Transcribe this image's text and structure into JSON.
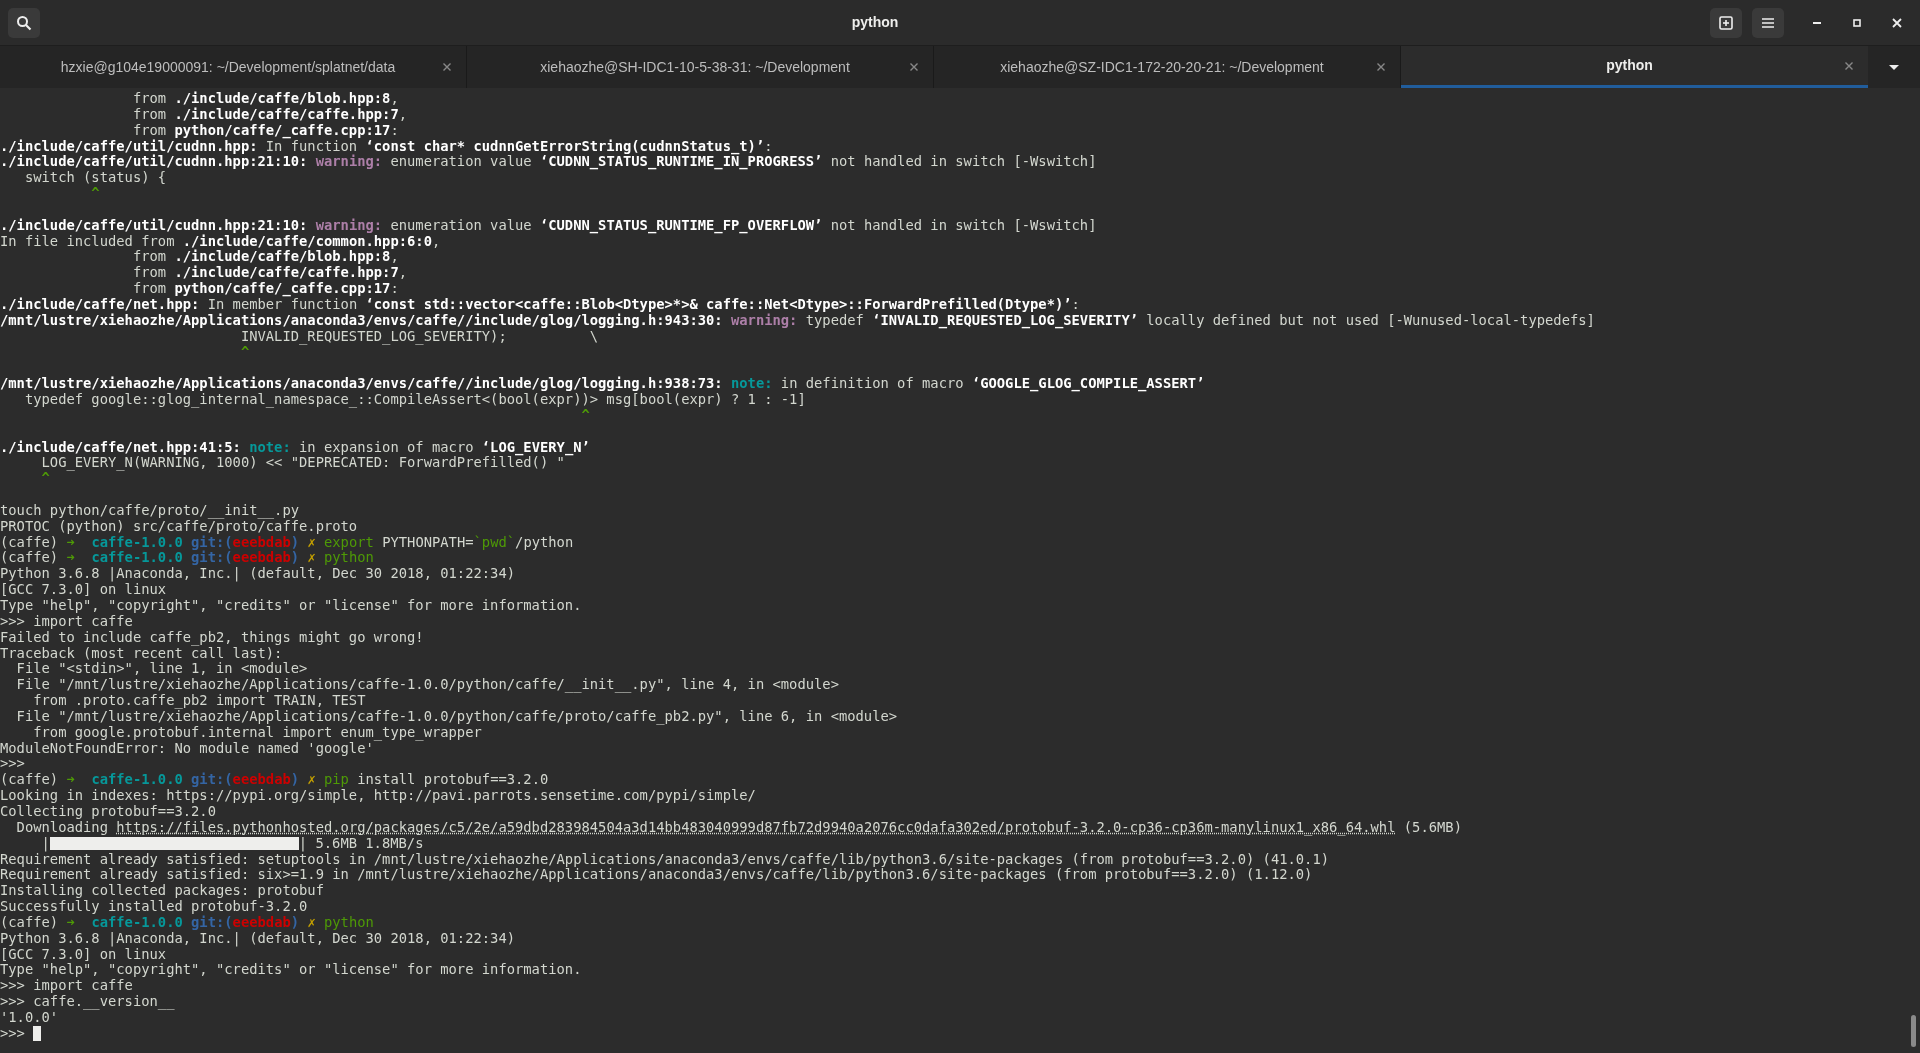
{
  "window": {
    "title": "python"
  },
  "tabs": [
    {
      "label": "hzxie@g104e19000091: ~/Development/splatnet/data",
      "selected": false
    },
    {
      "label": "xiehaozhe@SH-IDC1-10-5-38-31: ~/Development",
      "selected": false
    },
    {
      "label": "xiehaozhe@SZ-IDC1-172-20-20-21: ~/Development",
      "selected": false
    },
    {
      "label": "python",
      "selected": true
    }
  ],
  "terminal": {
    "lines": [
      {
        "segments": [
          {
            "kind": "text",
            "text": "                from "
          },
          {
            "kind": "bold",
            "text": "./include/caffe/blob.hpp:8"
          },
          {
            "kind": "text",
            "text": ","
          }
        ]
      },
      {
        "segments": [
          {
            "kind": "text",
            "text": "                from "
          },
          {
            "kind": "bold",
            "text": "./include/caffe/caffe.hpp:7"
          },
          {
            "kind": "text",
            "text": ","
          }
        ]
      },
      {
        "segments": [
          {
            "kind": "text",
            "text": "                from "
          },
          {
            "kind": "bold",
            "text": "python/caffe/_caffe.cpp:17"
          },
          {
            "kind": "text",
            "text": ":"
          }
        ]
      },
      {
        "segments": [
          {
            "kind": "bold",
            "text": "./include/caffe/util/cudnn.hpp:"
          },
          {
            "kind": "text",
            "text": " In function "
          },
          {
            "kind": "bold",
            "text": "‘const char* cudnnGetErrorString(cudnnStatus_t)’"
          },
          {
            "kind": "text",
            "text": ":"
          }
        ]
      },
      {
        "segments": [
          {
            "kind": "bold",
            "text": "./include/caffe/util/cudnn.hpp:21:10: "
          },
          {
            "kind": "warning",
            "text": "warning:"
          },
          {
            "kind": "text",
            "text": " enumeration value "
          },
          {
            "kind": "bold",
            "text": "‘CUDNN_STATUS_RUNTIME_IN_PROGRESS’"
          },
          {
            "kind": "text",
            "text": " not handled in switch [-Wswitch]"
          }
        ]
      },
      {
        "segments": [
          {
            "kind": "text",
            "text": "   switch (status) {"
          }
        ]
      },
      {
        "segments": [
          {
            "kind": "caret",
            "text": "           ^"
          }
        ]
      },
      {
        "kind": "blank"
      },
      {
        "segments": [
          {
            "kind": "bold",
            "text": "./include/caffe/util/cudnn.hpp:21:10: "
          },
          {
            "kind": "warning",
            "text": "warning:"
          },
          {
            "kind": "text",
            "text": " enumeration value "
          },
          {
            "kind": "bold",
            "text": "‘CUDNN_STATUS_RUNTIME_FP_OVERFLOW’"
          },
          {
            "kind": "text",
            "text": " not handled in switch [-Wswitch]"
          }
        ]
      },
      {
        "segments": [
          {
            "kind": "text",
            "text": "In file included from "
          },
          {
            "kind": "bold",
            "text": "./include/caffe/common.hpp:6:0"
          },
          {
            "kind": "text",
            "text": ","
          }
        ]
      },
      {
        "segments": [
          {
            "kind": "text",
            "text": "                from "
          },
          {
            "kind": "bold",
            "text": "./include/caffe/blob.hpp:8"
          },
          {
            "kind": "text",
            "text": ","
          }
        ]
      },
      {
        "segments": [
          {
            "kind": "text",
            "text": "                from "
          },
          {
            "kind": "bold",
            "text": "./include/caffe/caffe.hpp:7"
          },
          {
            "kind": "text",
            "text": ","
          }
        ]
      },
      {
        "segments": [
          {
            "kind": "text",
            "text": "                from "
          },
          {
            "kind": "bold",
            "text": "python/caffe/_caffe.cpp:17"
          },
          {
            "kind": "text",
            "text": ":"
          }
        ]
      },
      {
        "segments": [
          {
            "kind": "bold",
            "text": "./include/caffe/net.hpp:"
          },
          {
            "kind": "text",
            "text": " In member function "
          },
          {
            "kind": "bold",
            "text": "‘const std::vector<caffe::Blob<Dtype>*>& caffe::Net<Dtype>::ForwardPrefilled(Dtype*)’"
          },
          {
            "kind": "text",
            "text": ":"
          }
        ]
      },
      {
        "segments": [
          {
            "kind": "bold",
            "text": "/mnt/lustre/xiehaozhe/Applications/anaconda3/envs/caffe//include/glog/logging.h:943:30: "
          },
          {
            "kind": "warning",
            "text": "warning:"
          },
          {
            "kind": "text",
            "text": " typedef "
          },
          {
            "kind": "bold",
            "text": "‘INVALID_REQUESTED_LOG_SEVERITY’"
          },
          {
            "kind": "text",
            "text": " locally defined but not used [-Wunused-local-typedefs]"
          }
        ]
      },
      {
        "segments": [
          {
            "kind": "text",
            "text": "                             INVALID_REQUESTED_LOG_SEVERITY);          \\"
          }
        ]
      },
      {
        "segments": [
          {
            "kind": "caret",
            "text": "                             ^"
          }
        ]
      },
      {
        "kind": "blank"
      },
      {
        "segments": [
          {
            "kind": "bold",
            "text": "/mnt/lustre/xiehaozhe/Applications/anaconda3/envs/caffe//include/glog/logging.h:938:73: "
          },
          {
            "kind": "note",
            "text": "note:"
          },
          {
            "kind": "text",
            "text": " in definition of macro "
          },
          {
            "kind": "bold",
            "text": "‘GOOGLE_GLOG_COMPILE_ASSERT’"
          }
        ]
      },
      {
        "segments": [
          {
            "kind": "text",
            "text": "   typedef google::glog_internal_namespace_::CompileAssert<(bool(expr))> msg[bool(expr) ? 1 : -1]"
          }
        ]
      },
      {
        "segments": [
          {
            "kind": "caret",
            "text": "                                                                      ^"
          }
        ]
      },
      {
        "kind": "blank"
      },
      {
        "segments": [
          {
            "kind": "bold",
            "text": "./include/caffe/net.hpp:41:5: "
          },
          {
            "kind": "note",
            "text": "note:"
          },
          {
            "kind": "text",
            "text": " in expansion of macro "
          },
          {
            "kind": "bold",
            "text": "‘LOG_EVERY_N’"
          }
        ]
      },
      {
        "segments": [
          {
            "kind": "text",
            "text": "     LOG_EVERY_N(WARNING, 1000) << \"DEPRECATED: ForwardPrefilled() \""
          }
        ]
      },
      {
        "segments": [
          {
            "kind": "caret",
            "text": "     ^"
          }
        ]
      },
      {
        "kind": "blank"
      },
      {
        "segments": [
          {
            "kind": "text",
            "text": "touch python/caffe/proto/__init__.py"
          }
        ]
      },
      {
        "segments": [
          {
            "kind": "text",
            "text": "PROTOC (python) src/caffe/proto/caffe.proto"
          }
        ]
      },
      {
        "segments": [
          {
            "kind": "text",
            "text": "(caffe) "
          },
          {
            "kind": "arrow",
            "text": "➜  "
          },
          {
            "kind": "dir",
            "text": "caffe-1.0.0 "
          },
          {
            "kind": "git",
            "text": "git:("
          },
          {
            "kind": "hash",
            "text": "eeebdab"
          },
          {
            "kind": "git",
            "text": ")"
          },
          {
            "kind": "mark",
            "text": " ✗ "
          },
          {
            "kind": "cmd",
            "text": "export"
          },
          {
            "kind": "text",
            "text": " PYTHONPATH="
          },
          {
            "kind": "cmd",
            "text": "`pwd`"
          },
          {
            "kind": "text",
            "text": "/python"
          }
        ]
      },
      {
        "segments": [
          {
            "kind": "text",
            "text": "(caffe) "
          },
          {
            "kind": "arrow",
            "text": "➜  "
          },
          {
            "kind": "dir",
            "text": "caffe-1.0.0 "
          },
          {
            "kind": "git",
            "text": "git:("
          },
          {
            "kind": "hash",
            "text": "eeebdab"
          },
          {
            "kind": "git",
            "text": ")"
          },
          {
            "kind": "mark",
            "text": " ✗ "
          },
          {
            "kind": "cmd",
            "text": "python"
          }
        ]
      },
      {
        "segments": [
          {
            "kind": "text",
            "text": "Python 3.6.8 |Anaconda, Inc.| (default, Dec 30 2018, 01:22:34)"
          }
        ]
      },
      {
        "segments": [
          {
            "kind": "text",
            "text": "[GCC 7.3.0] on linux"
          }
        ]
      },
      {
        "segments": [
          {
            "kind": "text",
            "text": "Type \"help\", \"copyright\", \"credits\" or \"license\" for more information."
          }
        ]
      },
      {
        "segments": [
          {
            "kind": "text",
            "text": ">>> import caffe"
          }
        ]
      },
      {
        "segments": [
          {
            "kind": "text",
            "text": "Failed to include caffe_pb2, things might go wrong!"
          }
        ]
      },
      {
        "segments": [
          {
            "kind": "text",
            "text": "Traceback (most recent call last):"
          }
        ]
      },
      {
        "segments": [
          {
            "kind": "text",
            "text": "  File \"<stdin>\", line 1, in <module>"
          }
        ]
      },
      {
        "segments": [
          {
            "kind": "text",
            "text": "  File \"/mnt/lustre/xiehaozhe/Applications/caffe-1.0.0/python/caffe/__init__.py\", line 4, in <module>"
          }
        ]
      },
      {
        "segments": [
          {
            "kind": "text",
            "text": "    from .proto.caffe_pb2 import TRAIN, TEST"
          }
        ]
      },
      {
        "segments": [
          {
            "kind": "text",
            "text": "  File \"/mnt/lustre/xiehaozhe/Applications/caffe-1.0.0/python/caffe/proto/caffe_pb2.py\", line 6, in <module>"
          }
        ]
      },
      {
        "segments": [
          {
            "kind": "text",
            "text": "    from google.protobuf.internal import enum_type_wrapper"
          }
        ]
      },
      {
        "segments": [
          {
            "kind": "text",
            "text": "ModuleNotFoundError: No module named 'google'"
          }
        ]
      },
      {
        "segments": [
          {
            "kind": "text",
            "text": ">>>"
          }
        ]
      },
      {
        "segments": [
          {
            "kind": "text",
            "text": "(caffe) "
          },
          {
            "kind": "arrow",
            "text": "➜  "
          },
          {
            "kind": "dir",
            "text": "caffe-1.0.0 "
          },
          {
            "kind": "git",
            "text": "git:("
          },
          {
            "kind": "hash",
            "text": "eeebdab"
          },
          {
            "kind": "git",
            "text": ")"
          },
          {
            "kind": "mark",
            "text": " ✗ "
          },
          {
            "kind": "cmd",
            "text": "pip"
          },
          {
            "kind": "text",
            "text": " install protobuf==3.2.0"
          }
        ]
      },
      {
        "segments": [
          {
            "kind": "text",
            "text": "Looking in indexes: https://pypi.org/simple, http://pavi.parrots.sensetime.com/pypi/simple/"
          }
        ]
      },
      {
        "segments": [
          {
            "kind": "text",
            "text": "Collecting protobuf==3.2.0"
          }
        ]
      },
      {
        "segments": [
          {
            "kind": "text",
            "text": "  Downloading "
          },
          {
            "kind": "link",
            "text": "https://files.pythonhosted.org/packages/c5/2e/a59dbd283984504a3d14bb483040999d87fb72d9940a2076cc0dafa302ed/protobuf-3.2.0-cp36-cp36m-manylinux1_x86_64.whl"
          },
          {
            "kind": "text",
            "text": " (5.6MB)"
          }
        ]
      },
      {
        "segments": [
          {
            "kind": "text",
            "text": "     |"
          },
          {
            "kind": "bar",
            "level": 1
          },
          {
            "kind": "text",
            "text": "| 5.6MB 1.8MB/s"
          }
        ]
      },
      {
        "segments": [
          {
            "kind": "text",
            "text": "Requirement already satisfied: setuptools in /mnt/lustre/xiehaozhe/Applications/anaconda3/envs/caffe/lib/python3.6/site-packages (from protobuf==3.2.0) (41.0.1)"
          }
        ]
      },
      {
        "segments": [
          {
            "kind": "text",
            "text": "Requirement already satisfied: six>=1.9 in /mnt/lustre/xiehaozhe/Applications/anaconda3/envs/caffe/lib/python3.6/site-packages (from protobuf==3.2.0) (1.12.0)"
          }
        ]
      },
      {
        "segments": [
          {
            "kind": "text",
            "text": "Installing collected packages: protobuf"
          }
        ]
      },
      {
        "segments": [
          {
            "kind": "text",
            "text": "Successfully installed protobuf-3.2.0"
          }
        ]
      },
      {
        "segments": [
          {
            "kind": "text",
            "text": "(caffe) "
          },
          {
            "kind": "arrow",
            "text": "➜  "
          },
          {
            "kind": "dir",
            "text": "caffe-1.0.0 "
          },
          {
            "kind": "git",
            "text": "git:("
          },
          {
            "kind": "hash",
            "text": "eeebdab"
          },
          {
            "kind": "git",
            "text": ")"
          },
          {
            "kind": "mark",
            "text": " ✗ "
          },
          {
            "kind": "cmd",
            "text": "python"
          }
        ]
      },
      {
        "segments": [
          {
            "kind": "text",
            "text": "Python 3.6.8 |Anaconda, Inc.| (default, Dec 30 2018, 01:22:34)"
          }
        ]
      },
      {
        "segments": [
          {
            "kind": "text",
            "text": "[GCC 7.3.0] on linux"
          }
        ]
      },
      {
        "segments": [
          {
            "kind": "text",
            "text": "Type \"help\", \"copyright\", \"credits\" or \"license\" for more information."
          }
        ]
      },
      {
        "segments": [
          {
            "kind": "text",
            "text": ">>> import caffe"
          }
        ]
      },
      {
        "segments": [
          {
            "kind": "text",
            "text": ">>> caffe.__version__"
          }
        ]
      },
      {
        "segments": [
          {
            "kind": "text",
            "text": "'1.0.0'"
          }
        ]
      },
      {
        "segments": [
          {
            "kind": "text",
            "text": ">>> "
          },
          {
            "kind": "cursor"
          }
        ]
      }
    ]
  }
}
